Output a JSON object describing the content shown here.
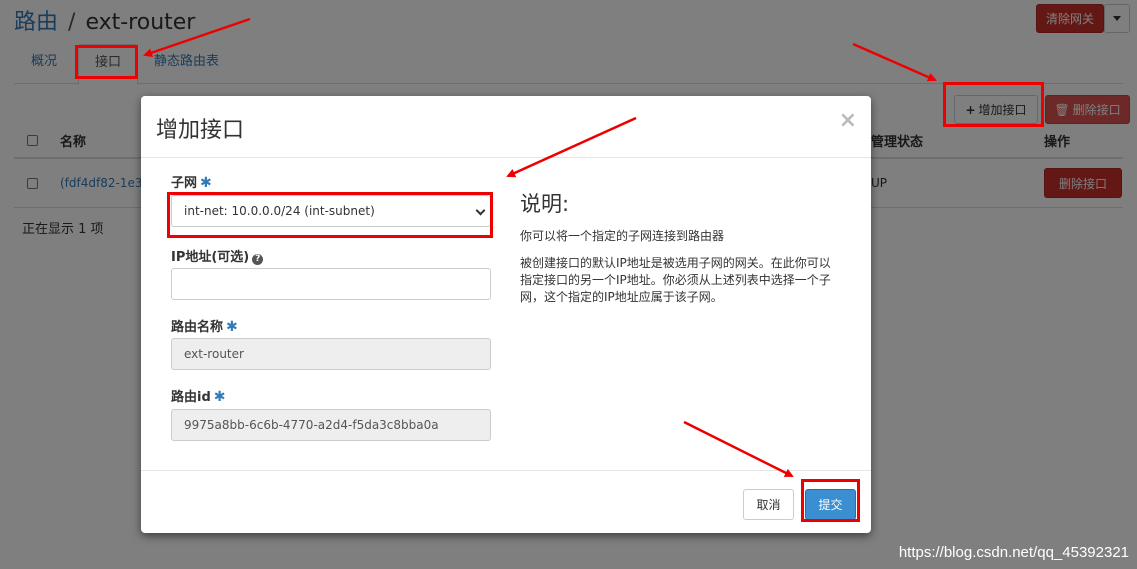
{
  "breadcrumb": {
    "root": "路由",
    "separator": "/",
    "current": "ext-router"
  },
  "header": {
    "clear_gateway": "清除网关"
  },
  "tabs": [
    {
      "label": "概况"
    },
    {
      "label": "接口"
    },
    {
      "label": "静态路由表"
    }
  ],
  "toolbar": {
    "add_interface": "增加接口",
    "delete_interface": "删除接口"
  },
  "table": {
    "headers": {
      "name": "名称",
      "admin_state": "管理状态",
      "actions": "操作"
    },
    "rows": [
      {
        "name": "(fdf4df82-1e3",
        "admin_state": "UP",
        "action": "删除接口"
      }
    ],
    "showing": "正在显示 1 项"
  },
  "modal": {
    "title": "增加接口",
    "close": "×",
    "fields": {
      "subnet": {
        "label": "子网",
        "value": "int-net: 10.0.0.0/24 (int-subnet)"
      },
      "ip": {
        "label": "IP地址(可选)",
        "value": ""
      },
      "router_name": {
        "label": "路由名称",
        "value": "ext-router"
      },
      "router_id": {
        "label": "路由id",
        "value": "9975a8bb-6c6b-4770-a2d4-f5da3c8bba0a"
      }
    },
    "description": {
      "title": "说明:",
      "p1": "你可以将一个指定的子网连接到路由器",
      "p2": "被创建接口的默认IP地址是被选用子网的网关。在此你可以指定接口的另一个IP地址。你必须从上述列表中选择一个子网，这个指定的IP地址应属于该子网。"
    },
    "buttons": {
      "cancel": "取消",
      "submit": "提交"
    }
  },
  "required_mark": "✱",
  "watermark": "https://blog.csdn.net/qq_45392321",
  "colors": {
    "link": "#337ab7",
    "danger": "#c9302c",
    "primary": "#3b8ed0",
    "annotation": "#e00000"
  }
}
